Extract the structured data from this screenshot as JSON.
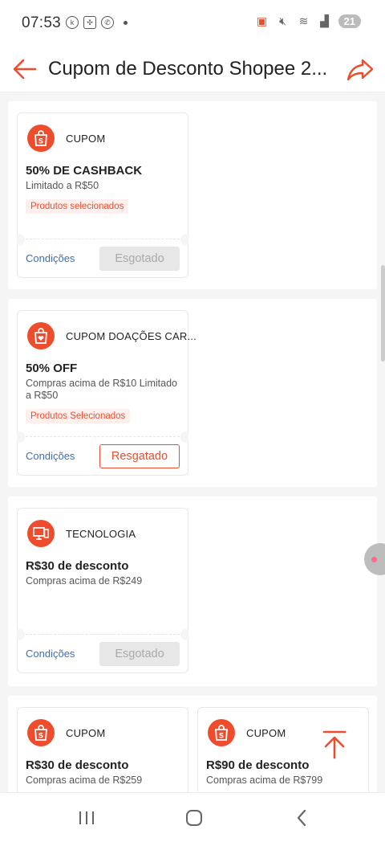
{
  "status_bar": {
    "time": "07:53",
    "battery": "21"
  },
  "header": {
    "title": "Cupom de Desconto Shopee 2..."
  },
  "coupons": [
    {
      "category": "CUPOM",
      "amount": "50% DE CASHBACK",
      "desc": "Limitado a R$50",
      "tag": "Produtos selecionados",
      "conditions": "Condições",
      "action": "Esgotado",
      "state": "sold_out"
    },
    {
      "category": "CUPOM DOAÇÕES CAR...",
      "amount": "50% OFF",
      "desc": "Compras acima de R$10 Limitado a R$50",
      "tag": "Produtos Selecionados",
      "conditions": "Condições",
      "action": "Resgatado",
      "state": "redeemed"
    },
    {
      "category": "TECNOLOGIA",
      "amount": "R$30 de desconto",
      "desc": "Compras acima de R$249",
      "tag": "",
      "conditions": "Condições",
      "action": "Esgotado",
      "state": "sold_out"
    },
    {
      "category": "CUPOM",
      "amount": "R$30 de desconto",
      "desc": "Compras acima de R$259"
    },
    {
      "category": "CUPOM",
      "amount": "R$90 de desconto",
      "desc": "Compras acima de R$799"
    }
  ],
  "colors": {
    "brand": "#ee4d2d",
    "link": "#3b6fb6"
  }
}
